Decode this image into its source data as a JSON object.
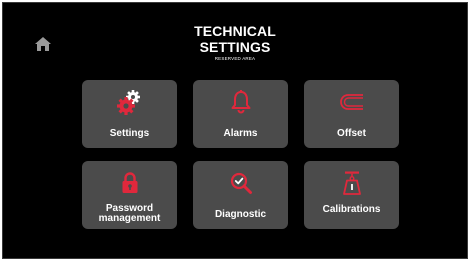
{
  "header": {
    "title_line1": "TECHNICAL",
    "title_line2": "SETTINGS",
    "subtitle": "RESERVED AREA"
  },
  "nav": {
    "home_icon": "home-icon"
  },
  "tiles": [
    {
      "label": "Settings",
      "icon": "gears-icon"
    },
    {
      "label": "Alarms",
      "icon": "bell-icon"
    },
    {
      "label": "Offset",
      "icon": "offset-icon"
    },
    {
      "label_line1": "Password",
      "label_line2": "management",
      "icon": "lock-icon"
    },
    {
      "label": "Diagnostic",
      "icon": "magnifier-check-icon"
    },
    {
      "label": "Calibrations",
      "icon": "scale-weight-icon"
    }
  ],
  "colors": {
    "background": "#000000",
    "tile": "#4b4b4b",
    "accent": "#e0283c",
    "text": "#ffffff",
    "icon_neutral": "#ffffff"
  }
}
